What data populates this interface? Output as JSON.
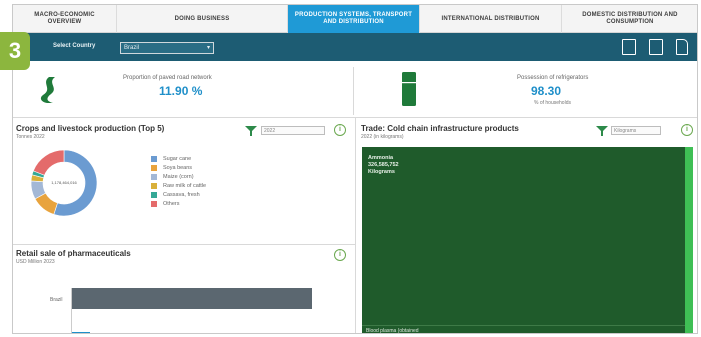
{
  "tabs": [
    {
      "label": "MACRO-ECONOMIC OVERVIEW",
      "active": false
    },
    {
      "label": "DOING BUSINESS",
      "active": false
    },
    {
      "label": "PRODUCTION SYSTEMS, TRANSPORT AND DISTRIBUTION",
      "active": true
    },
    {
      "label": "INTERNATIONAL DISTRIBUTION",
      "active": false
    },
    {
      "label": "DOMESTIC DISTRIBUTION AND CONSUMPTION",
      "active": false
    }
  ],
  "step_badge": "3",
  "filter": {
    "label": "Select Country",
    "value": "Brazil"
  },
  "kpi_roads": {
    "caption": "Proportion of paved road network",
    "value": "11.90 %"
  },
  "kpi_fridge": {
    "caption": "Possession of refrigerators",
    "value": "98.30",
    "unit": "% of households"
  },
  "crops": {
    "title": "Crops and livestock production (Top 5)",
    "subtitle": "Tonnes 2022",
    "select": "2022",
    "donut_center": "1,178,464,016",
    "legend": [
      {
        "label": "Sugar cane",
        "color": "#6b9bd1"
      },
      {
        "label": "Soya beans",
        "color": "#e8a33d"
      },
      {
        "label": "Maize (corn)",
        "color": "#a3b8d6"
      },
      {
        "label": "Raw milk of cattle",
        "color": "#d9b03a"
      },
      {
        "label": "Cassava, fresh",
        "color": "#35a896"
      },
      {
        "label": "Others",
        "color": "#e46b6b"
      }
    ]
  },
  "chart_data": {
    "type": "pie",
    "categories": [
      "Sugar cane",
      "Soya beans",
      "Maize (corn)",
      "Raw milk of cattle",
      "Cassava, fresh",
      "Others"
    ],
    "values": [
      55,
      12,
      9,
      3,
      2,
      19
    ]
  },
  "pharma": {
    "title": "Retail sale of pharmaceuticals",
    "subtitle": "USD Million 2023",
    "bar_label": "Brazil"
  },
  "cold_chain": {
    "title": "Trade: Cold chain infrastructure products",
    "subtitle": "2022 (in kilograms)",
    "select": "Kilograms",
    "top_item": "Ammonia",
    "top_value": "326,585,752",
    "top_unit": "Kilograms",
    "footer_item": "Blood plasma (obtained"
  }
}
